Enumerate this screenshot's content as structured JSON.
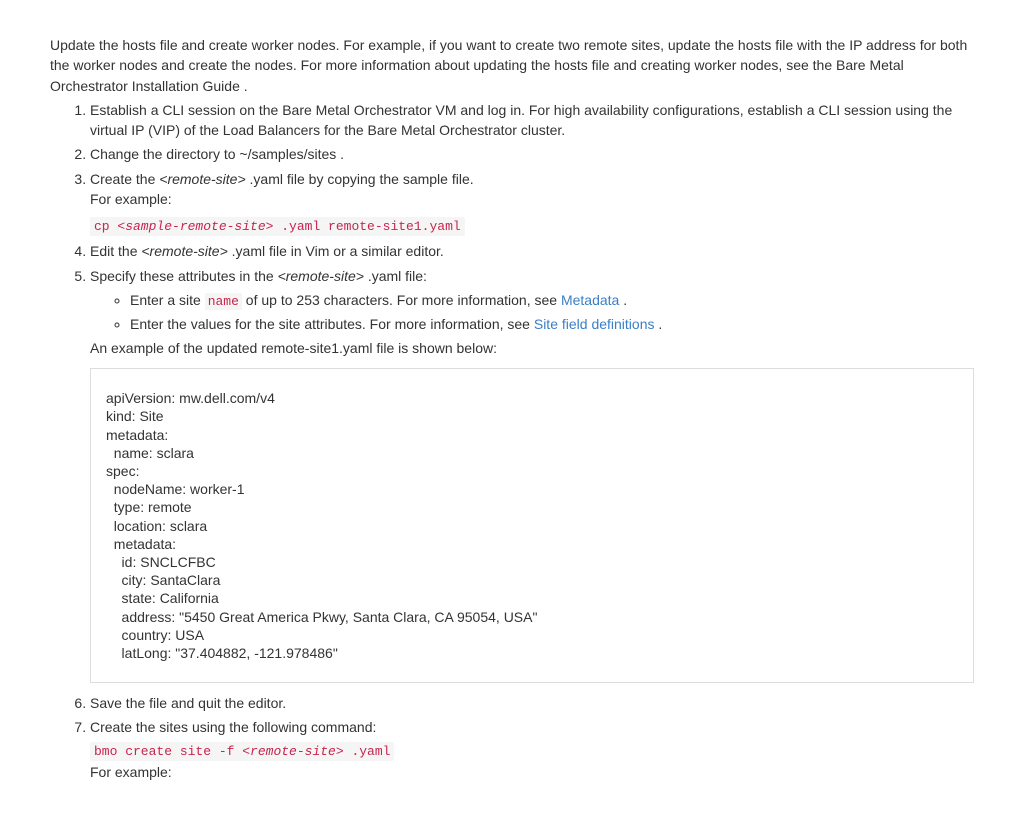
{
  "intro": "Update the hosts file and create worker nodes. For example, if you want to create two remote sites, update the hosts file with the IP address for both the worker nodes and create the nodes. For more information about updating the hosts file and creating worker nodes, see the Bare Metal Orchestrator Installation Guide .",
  "steps": {
    "s1": "Establish a CLI session on the Bare Metal Orchestrator VM and log in. For high availability configurations, establish a CLI session using the virtual IP (VIP) of the Load Balancers for the Bare Metal Orchestrator cluster.",
    "s2_a": "Change the directory to ",
    "s2_path": "~/samples/sites",
    "s2_b": " .",
    "s3_a": "Create the ",
    "s3_var": "<remote-site>",
    "s3_b": " .yaml file by copying the sample file.",
    "s3_eg": "For example:",
    "s3_cmd_a": "cp ",
    "s3_cmd_var": "<sample-remote-site>",
    "s3_cmd_b": " .yaml remote-site1.yaml",
    "s4_a": "Edit the ",
    "s4_var": "<remote-site>",
    "s4_b": " .yaml file in Vim or a similar editor.",
    "s5_a": "Specify these attributes in the ",
    "s5_var": "<remote-site>",
    "s5_b": " .yaml file:",
    "s5_sub1_a": "Enter a site ",
    "s5_sub1_kw": "name",
    "s5_sub1_b": " of up to 253 characters. For more information, see ",
    "s5_sub1_link": "Metadata",
    "s5_sub1_c": " .",
    "s5_sub2_a": "Enter the values for the site attributes. For more information, see ",
    "s5_sub2_link": "Site field definitions",
    "s5_sub2_b": " .",
    "s5_eg": "An example of the updated remote-site1.yaml file is shown below:",
    "yaml": "apiVersion: mw.dell.com/v4\nkind: Site\nmetadata:\n  name: sclara\nspec:\n  nodeName: worker-1\n  type: remote\n  location: sclara\n  metadata:\n    id: SNCLCFBC\n    city: SantaClara\n    state: California\n    address: \"5450 Great America Pkwy, Santa Clara, CA 95054, USA\"\n    country: USA\n    latLong: \"37.404882, -121.978486\"",
    "s6": "Save the file and quit the editor.",
    "s7_a": "Create the sites using the following command:",
    "s7_cmd_a": "bmo create site -f ",
    "s7_cmd_var": "<remote-site>",
    "s7_cmd_b": " .yaml",
    "s7_eg": "For example:"
  }
}
